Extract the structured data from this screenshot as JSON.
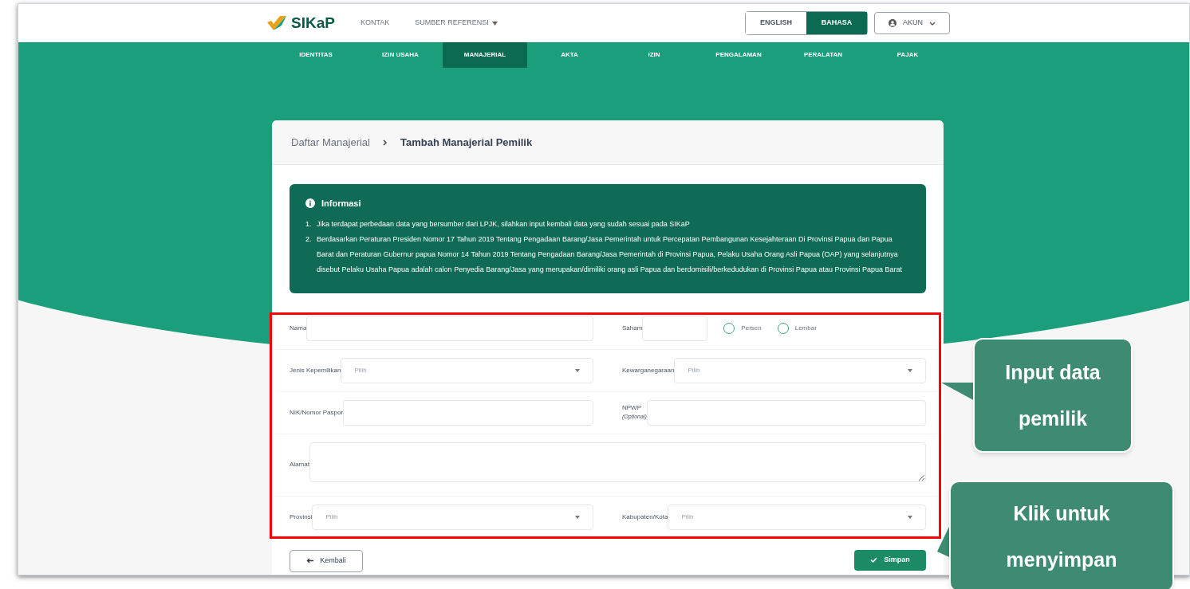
{
  "header": {
    "logo": "SIKaP",
    "links": [
      {
        "label": "KONTAK",
        "dropdown": false
      },
      {
        "label": "SUMBER REFERENSI",
        "dropdown": true
      }
    ],
    "languages": [
      {
        "label": "ENGLISH",
        "selected": false
      },
      {
        "label": "BAHASA",
        "selected": true
      }
    ],
    "account": "AKUN"
  },
  "tabs": [
    {
      "label": "IDENTITAS",
      "selected": false
    },
    {
      "label": "IZIN USAHA",
      "selected": false
    },
    {
      "label": "MANAJERIAL",
      "selected": true
    },
    {
      "label": "AKTA",
      "selected": false
    },
    {
      "label": "IZIN",
      "selected": false
    },
    {
      "label": "PENGALAMAN",
      "selected": false
    },
    {
      "label": "PERALATAN",
      "selected": false
    },
    {
      "label": "PAJAK",
      "selected": false
    }
  ],
  "breadcrumb": [
    "Daftar Manajerial",
    "Tambah Manajerial Pemilik"
  ],
  "info": {
    "title": "Informasi",
    "items": [
      {
        "number": "1.",
        "text": "Jika terdapat perbedaan data yang bersumber dari LPJK, silahkan input kembali data yang sudah sesuai pada SIKaP"
      },
      {
        "number": "2.",
        "text": "Berdasarkan Peraturan Presiden Nomor 17 Tahun 2019 Tentang Pengadaan Barang/Jasa Pemerintah untuk Percepatan Pembangunan Kesejahteraan Di Provinsi Papua dan Papua Barat dan Peraturan Gubernur papua Nomor 14 Tahun 2019 Tentang Pengadaan Barang/Jasa Pemerintah di Provinsi Papua, Pelaku Usaha Orang Asli Papua (OAP) yang selanjutnya disebut Pelaku Usaha Papua adalah calon Penyedia Barang/Jasa yang merupakan/dimiliki orang asli Papua dan berdomisili/berkedudukan di Provinsi Papua atau Provinsi Papua Barat"
      }
    ]
  },
  "form": [
    [
      {
        "kind": "text",
        "label": "Nama"
      },
      {
        "kind": "shares",
        "label": "Saham",
        "options": [
          {
            "label": "Persen",
            "selected": false
          },
          {
            "label": "Lembar",
            "selected": false
          }
        ]
      }
    ],
    [
      {
        "kind": "select",
        "label": "Jenis Kepemilikan",
        "placeholder": "Pilih"
      },
      {
        "kind": "select",
        "label": "Kewarganegaraan",
        "placeholder": "Pilih"
      }
    ],
    [
      {
        "kind": "text",
        "label": "NIK/Nomor Paspor"
      },
      {
        "kind": "text",
        "label": "NPWP",
        "note": "(Optional)"
      }
    ],
    [
      {
        "kind": "textarea",
        "label": "Alamat"
      }
    ],
    [
      {
        "kind": "select",
        "label": "Provinsi",
        "placeholder": "Pilih"
      },
      {
        "kind": "select",
        "label": "Kabupaten/Kota",
        "placeholder": "Pilih"
      }
    ]
  ],
  "buttons": {
    "back": "Kembali",
    "save": "Simpan"
  },
  "callouts": [
    "Input data pemilik",
    "Klik untuk menyimpan"
  ]
}
